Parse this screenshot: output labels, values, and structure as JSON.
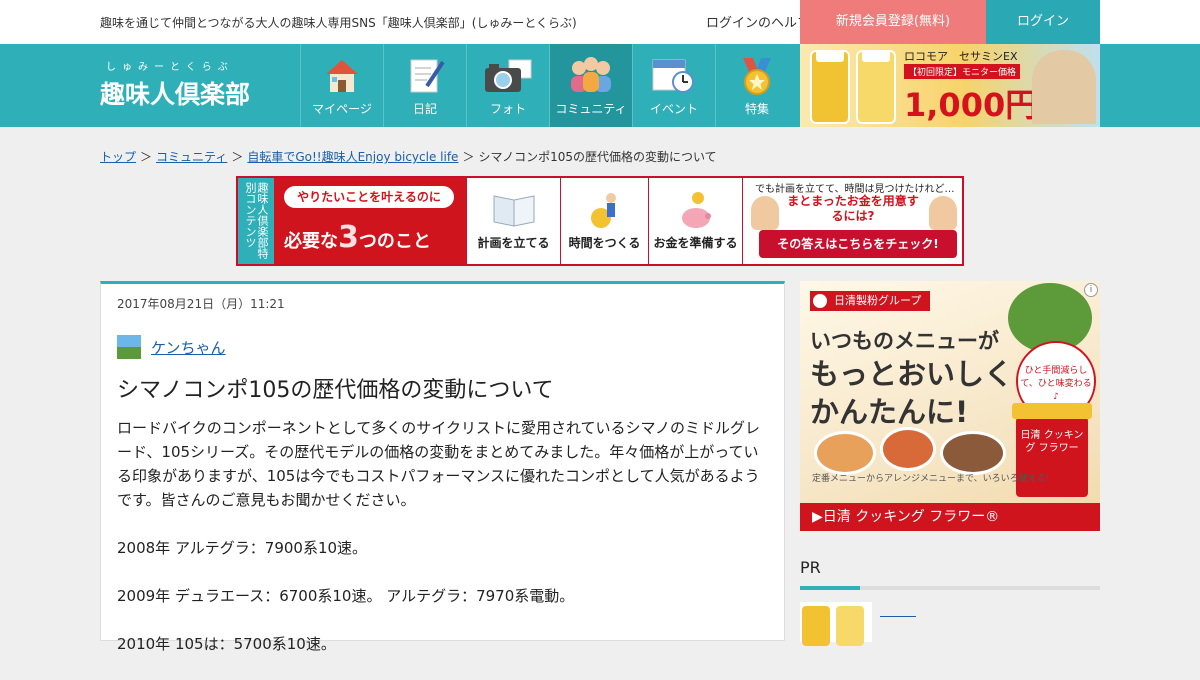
{
  "topbar": {
    "tagline": "趣味を通じて仲間とつながる大人の趣味人専用SNS「趣味人倶楽部」(しゅみーとくらぶ)",
    "login_help": "ログインのヘルプ",
    "register": "新規会員登録(無料)",
    "login": "ログイン"
  },
  "nav": {
    "logo_kana": "しゅみーとくらぶ",
    "logo_name": "趣味人倶楽部",
    "items": [
      {
        "label": "マイページ",
        "icon": "house-icon"
      },
      {
        "label": "日記",
        "icon": "notebook-pen-icon"
      },
      {
        "label": "フォト",
        "icon": "camera-icon"
      },
      {
        "label": "コミュニティ",
        "icon": "people-icon"
      },
      {
        "label": "イベント",
        "icon": "calendar-clock-icon"
      },
      {
        "label": "特集",
        "icon": "medal-icon"
      }
    ],
    "ad": {
      "line1": "ロコモア　セサミンEX",
      "line2": "【初回限定】モニター価格",
      "price": "1,000円"
    }
  },
  "breadcrumb": {
    "items": [
      "トップ",
      "コミュニティ",
      "自転車でGo!!趣味人Enjoy bicycle life"
    ],
    "current": "シマノコンポ105の歴代価格の変動について"
  },
  "banner": {
    "side": "趣味人倶楽部特別コンテンツ",
    "pill": "やりたいことを叶えるのに",
    "headline_pre": "必要な",
    "headline_num": "3",
    "headline_post": "つのこと",
    "cells": [
      "計画を立てる",
      "時間をつくる",
      "お金を準備する"
    ],
    "q1": "でも計画を立てて、時間は見つけたけれど…",
    "q2": "まとまったお金を用意するには?",
    "cta": "その答えはこちらをチェック!"
  },
  "article": {
    "date": "2017年08月21日（月）11:21",
    "author": "ケンちゃん",
    "title": "シマノコンポ105の歴代価格の変動について",
    "paragraphs": [
      "ロードバイクのコンポーネントとして多くのサイクリストに愛用されているシマノのミドルグレード、105シリーズ。その歴代モデルの価格の変動をまとめてみました。年々価格が上がっている印象がありますが、105は今でもコストパフォーマンスに優れたコンポとして人気があるようです。皆さんのご意見もお聞かせください。",
      "2008年 アルテグラ：7900系10速。",
      "2009年 デュラエース：6700系10速。 アルテグラ：7970系電動。",
      "2010年 105は：5700系10速。"
    ]
  },
  "ad": {
    "brand": "日清製粉グループ",
    "h1": "いつものメニューが",
    "h2a": "もっとおいしく",
    "h2b": "かんたんに!",
    "badge": "ひと手間減らして、ひと味変わる♪",
    "can": "日清 クッキング フラワー",
    "sub": "定番メニューからアレンジメニューまで、いろいろ使える!",
    "foot": "▶日清 クッキング フラワー®"
  },
  "pr": {
    "heading": "PR"
  },
  "colors": {
    "teal": "#2fb0b8",
    "coral": "#ef7b7b",
    "red": "#d0141e"
  }
}
